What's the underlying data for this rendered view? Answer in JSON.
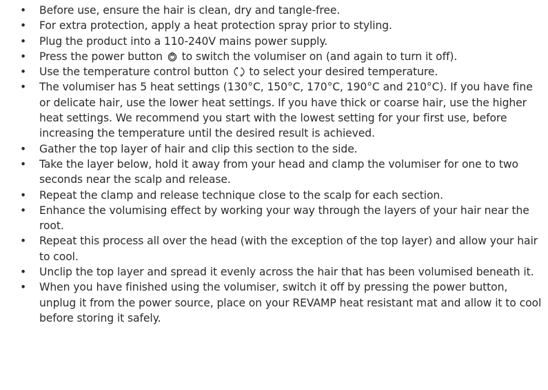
{
  "bullet_char": "•",
  "instructions": [
    {
      "text": "Before use, ensure the hair is clean, dry and tangle-free."
    },
    {
      "text": "For extra protection, apply a heat protection spray prior to styling."
    },
    {
      "text": "Plug the product into a 110-240V mains power supply."
    },
    {
      "text_before": "Press the power button",
      "icon": "power-icon",
      "text_after": "to switch the volumiser on (and again to turn it off)."
    },
    {
      "text_before": "Use the temperature control button",
      "icon": "temperature-control-icon",
      "text_after": "to select your desired temperature."
    },
    {
      "text": "The volumiser has 5 heat settings (130°C, 150°C, 170°C, 190°C and 210°C). If you have fine or delicate hair, use the lower heat settings. If you have thick or coarse hair, use the higher heat settings. We recommend you start with the lowest setting for your first use, before increasing the temperature until the desired result is achieved."
    },
    {
      "text": "Gather the top layer of hair and clip this section to the side."
    },
    {
      "text": "Take the layer below, hold it away from your head and clamp the volumiser for one to two seconds near the scalp and release."
    },
    {
      "text": "Repeat the clamp and release technique close to the scalp for each section."
    },
    {
      "text": "Enhance the volumising effect by working your way through the layers of your hair near the root."
    },
    {
      "text": "Repeat this process all over the head (with the exception of the top layer) and allow your hair to cool."
    },
    {
      "text": "Unclip the top layer and spread it evenly across the hair that has been volumised beneath it."
    },
    {
      "text": "When you have finished using the volumiser, switch it off by pressing the power button, unplug it from the power source, place on your REVAMP heat resistant mat and allow it to cool before storing it safely."
    }
  ]
}
